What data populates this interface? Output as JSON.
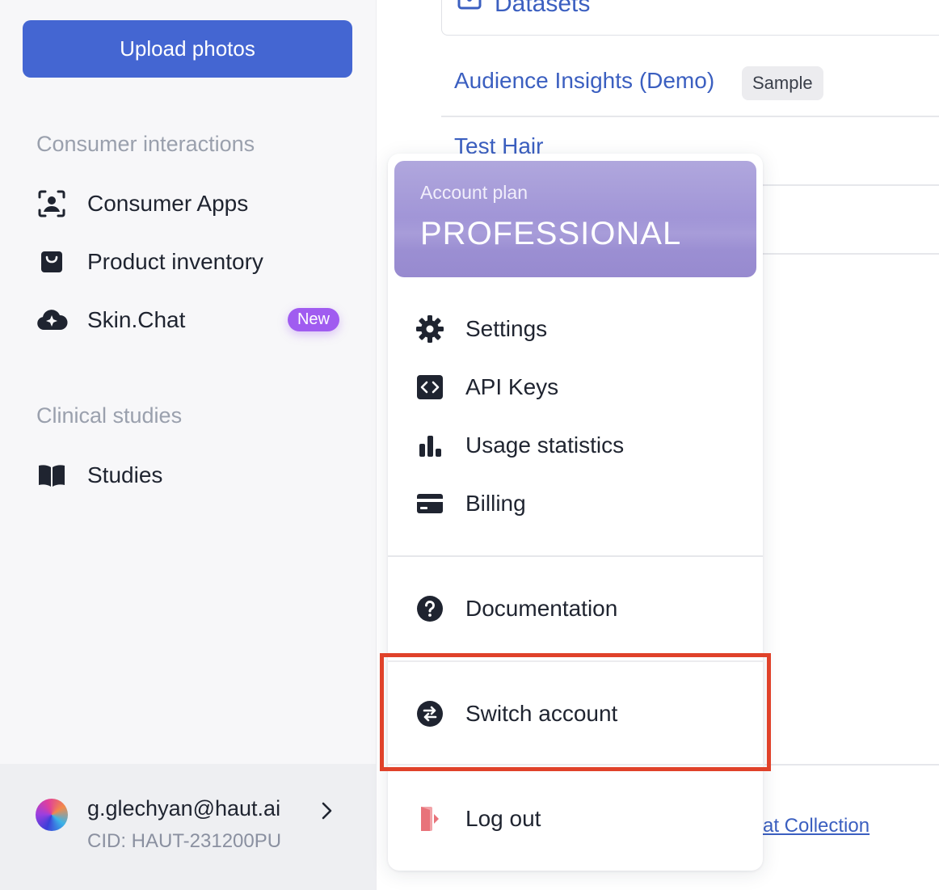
{
  "sidebar": {
    "upload_button": "Upload photos",
    "sections": [
      {
        "title": "Consumer interactions",
        "items": [
          {
            "label": "Consumer Apps",
            "icon": "consumer-scan-icon"
          },
          {
            "label": "Product inventory",
            "icon": "shopping-bag-icon"
          },
          {
            "label": "Skin.Chat",
            "icon": "cloud-sparkle-icon",
            "badge": "New"
          }
        ]
      },
      {
        "title": "Clinical studies",
        "items": [
          {
            "label": "Studies",
            "icon": "book-open-icon"
          }
        ]
      }
    ],
    "user": {
      "email": "g.glechyan@haut.ai",
      "cid": "CID: HAUT-231200PU"
    }
  },
  "main": {
    "datasets_title": "Datasets",
    "rows": [
      {
        "name": "Audience Insights (Demo)",
        "badge": "Sample"
      },
      {
        "name": "Test Hair"
      }
    ],
    "bottom_link": "at Collection"
  },
  "account_menu": {
    "plan_label": "Account plan",
    "plan_name": "PROFESSIONAL",
    "items": [
      {
        "label": "Settings",
        "icon": "gear-icon"
      },
      {
        "label": "API Keys",
        "icon": "code-brackets-icon"
      },
      {
        "label": "Usage statistics",
        "icon": "bar-chart-icon"
      },
      {
        "label": "Billing",
        "icon": "credit-card-icon"
      }
    ],
    "secondary_items": [
      {
        "label": "Documentation",
        "icon": "question-circle-icon"
      },
      {
        "label": "Switch account",
        "icon": "switch-arrows-icon",
        "highlighted": true
      },
      {
        "label": "Log out",
        "icon": "logout-door-icon"
      }
    ]
  },
  "colors": {
    "primary": "#4466d2",
    "link": "#3b5fc0",
    "badge_new": "#a05cf0",
    "highlight": "#e0422a",
    "logout": "#e8737a"
  }
}
